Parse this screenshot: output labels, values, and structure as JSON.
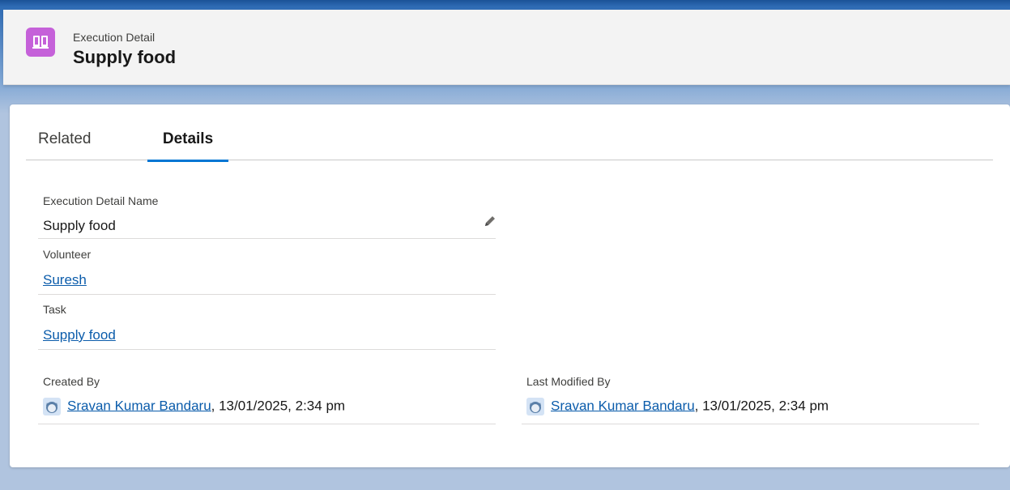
{
  "header": {
    "object_label": "Execution Detail",
    "record_title": "Supply food",
    "icon": "book-icon",
    "icon_color": "#c561d9"
  },
  "tabs": [
    {
      "label": "Related",
      "active": false
    },
    {
      "label": "Details",
      "active": true
    }
  ],
  "fields": {
    "name": {
      "label": "Execution Detail Name",
      "value": "Supply food"
    },
    "volunteer": {
      "label": "Volunteer",
      "value": "Suresh"
    },
    "task": {
      "label": "Task",
      "value": "Supply food"
    }
  },
  "created": {
    "label": "Created By",
    "user": "Sravan Kumar Bandaru",
    "date": ", 13/01/2025, 2:34 pm"
  },
  "modified": {
    "label": "Last Modified By",
    "user": "Sravan Kumar Bandaru",
    "date": ", 13/01/2025, 2:34 pm"
  },
  "colors": {
    "link": "#0b5cab",
    "tab_underline": "#0176d3",
    "background": "#b0c4df"
  }
}
